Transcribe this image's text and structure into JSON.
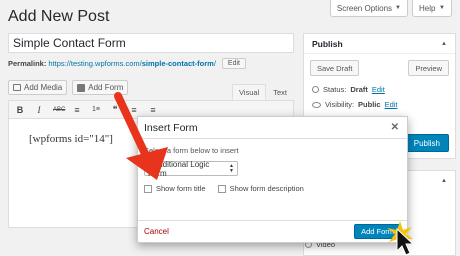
{
  "header": {
    "screen_options": "Screen Options",
    "help": "Help",
    "page_title": "Add New Post"
  },
  "post": {
    "title": "Simple Contact Form",
    "permalink_label": "Permalink:",
    "permalink_prefix": "https://testing.wpforms.com/",
    "permalink_slug": "simple-contact-form",
    "permalink_suffix": "/",
    "edit_label": "Edit"
  },
  "editor": {
    "add_media": "Add Media",
    "add_form": "Add Form",
    "tab_visual": "Visual",
    "tab_text": "Text",
    "toolbar": [
      "B",
      "I",
      "ABC",
      "≡",
      "1≡",
      "❝",
      "≡",
      "≡"
    ],
    "content": "[wpforms id=\"14\"]"
  },
  "publish": {
    "heading": "Publish",
    "save_draft": "Save Draft",
    "preview": "Preview",
    "status_label": "Status:",
    "status_value": "Draft",
    "visibility_label": "Visibility:",
    "visibility_value": "Public",
    "edit": "Edit",
    "publish_btn": "Publish"
  },
  "format": {
    "video": "Video"
  },
  "modal": {
    "title": "Insert Form",
    "instruction": "Select a form below to insert",
    "selected_form": "Conditional Logic Form",
    "show_title": "Show form title",
    "show_description": "Show form description",
    "cancel": "Cancel",
    "add_form": "Add Form"
  },
  "colors": {
    "primary": "#0085ba",
    "link": "#0073aa",
    "arrow": "#e8341c",
    "cancel": "#a00000"
  }
}
